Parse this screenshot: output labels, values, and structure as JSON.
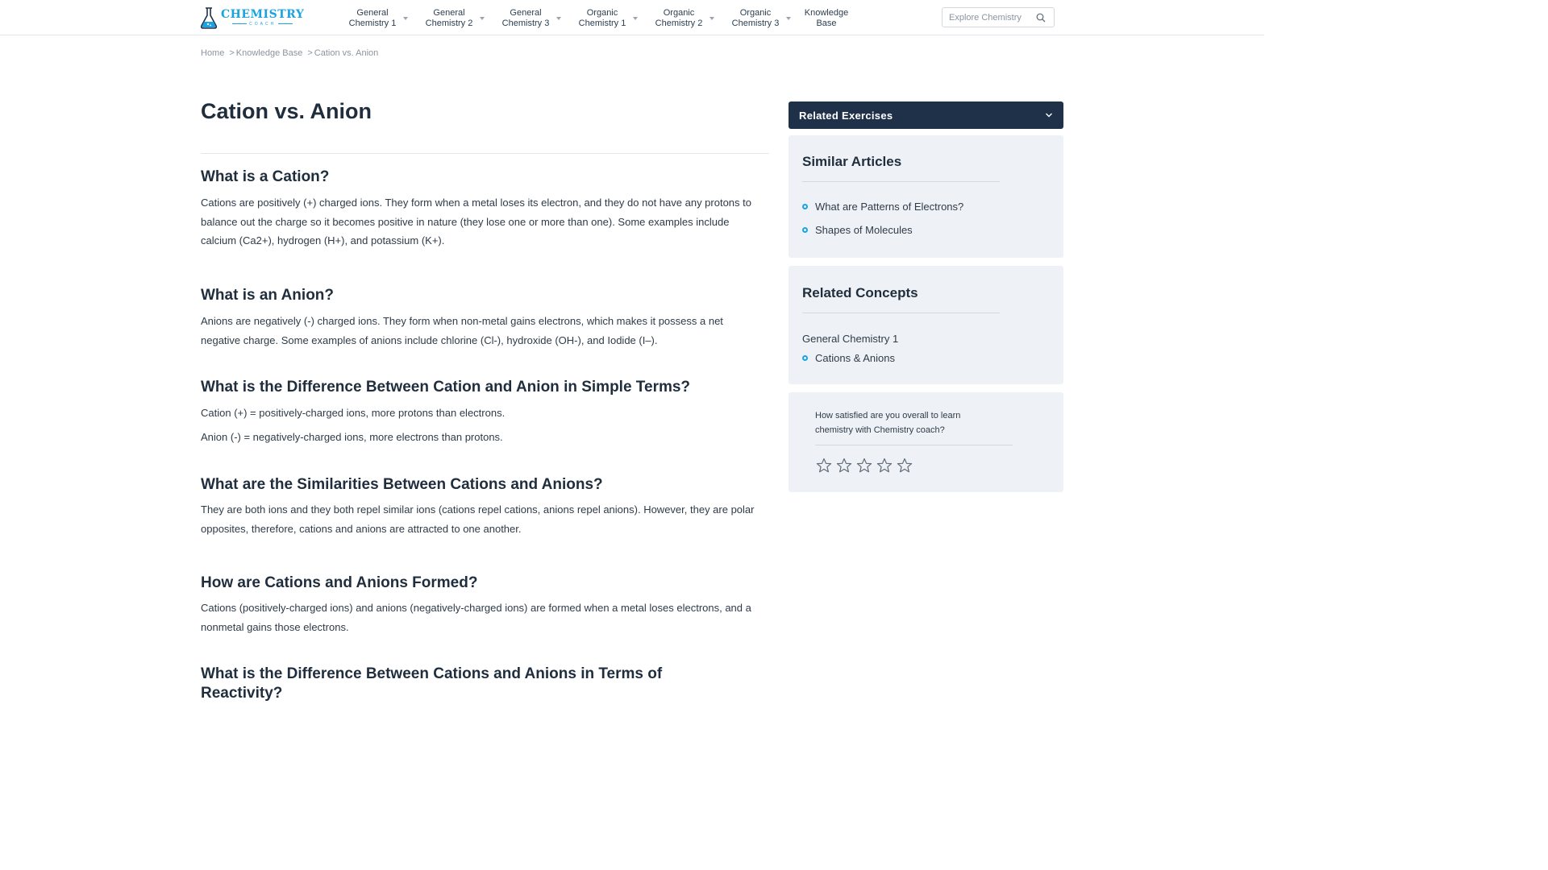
{
  "logo": {
    "main": "CHEMISTRY",
    "sub": "COACH",
    "icon": "flask-icon"
  },
  "nav": [
    {
      "label": "General Chemistry 1",
      "has_caret": true
    },
    {
      "label": "General Chemistry 2",
      "has_caret": true
    },
    {
      "label": "General Chemistry 3",
      "has_caret": true
    },
    {
      "label": "Organic Chemistry 1",
      "has_caret": true
    },
    {
      "label": "Organic Chemistry 2",
      "has_caret": true
    },
    {
      "label": "Organic Chemistry 3",
      "has_caret": true
    },
    {
      "label": "Knowledge Base",
      "has_caret": false
    }
  ],
  "search": {
    "placeholder": "Explore Chemistry",
    "icon": "search-icon"
  },
  "breadcrumb": [
    {
      "label": "Home"
    },
    {
      "label": "Knowledge Base"
    },
    {
      "label": "Cation vs. Anion"
    }
  ],
  "breadcrumb_separator": ">",
  "article": {
    "title": "Cation vs. Anion",
    "sections": [
      {
        "heading": "What is a Cation?",
        "paragraphs": [
          "Cations are positively (+) charged ions. They form when a metal loses its electron, and they do not have any protons to balance out the charge so it becomes positive in nature (they lose one or more than one). Some examples include calcium (Ca2+), hydrogen (H+), and potassium (K+)."
        ]
      },
      {
        "heading": "What is an Anion?",
        "paragraphs": [
          "Anions are negatively (-) charged ions. They form when non-metal gains electrons, which makes it possess a net negative charge. Some examples of anions include chlorine (Cl-), hydroxide (OH-), and Iodide (I–)."
        ]
      },
      {
        "heading": "What is the Difference Between Cation and Anion in Simple Terms?",
        "paragraphs": [
          "Cation (+) = positively-charged ions, more protons than electrons.",
          "Anion (-) = negatively-charged ions, more electrons than protons."
        ]
      },
      {
        "heading": "What are the Similarities Between Cations and Anions?",
        "paragraphs": [
          "They are both ions and they both repel similar ions (cations repel cations, anions repel anions). However, they are polar opposites, therefore, cations and anions are attracted to one another."
        ]
      },
      {
        "heading": "How are Cations and Anions Formed?",
        "paragraphs": [
          "Cations (positively-charged ions) and anions (negatively-charged ions) are formed when a metal loses electrons, and a nonmetal gains those electrons."
        ]
      },
      {
        "heading": "What is the Difference Between Cations and Anions in Terms of Reactivity?",
        "paragraphs": []
      }
    ]
  },
  "sidebar": {
    "related_exercises": {
      "label": "Related Exercises",
      "icon": "chevron-down-icon"
    },
    "similar_articles": {
      "title": "Similar Articles",
      "items": [
        "What are Patterns of Electrons?",
        "Shapes of Molecules"
      ]
    },
    "related_concepts": {
      "title": "Related Concepts",
      "group": "General Chemistry 1",
      "items": [
        "Cations & Anions"
      ]
    },
    "survey": {
      "question": "How satisfied are you overall to learn chemistry with Chemistry coach?",
      "rating": 0,
      "max": 5,
      "icon": "star-outline-icon"
    }
  },
  "colors": {
    "accent": "#1aa3e0",
    "dark_navy": "#1e3148",
    "card_bg": "#eef2f6",
    "text": "#1f2d3d"
  }
}
